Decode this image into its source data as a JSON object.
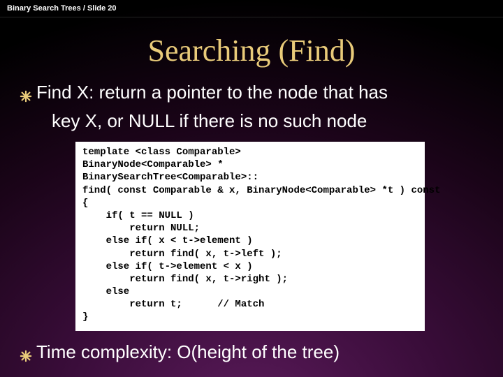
{
  "header": "Binary Search Trees / Slide 20",
  "title": "Searching (Find)",
  "bullets": {
    "b1_part1": "Find X: return a pointer to the node that has",
    "b1_part2": "key X, or NULL if there is no such node",
    "b2": "Time complexity: O(height of the tree)"
  },
  "code": "template <class Comparable>\nBinaryNode<Comparable> *\nBinarySearchTree<Comparable>::\nfind( const Comparable & x, BinaryNode<Comparable> *t ) const\n{\n    if( t == NULL )\n        return NULL;\n    else if( x < t->element )\n        return find( x, t->left );\n    else if( t->element < x )\n        return find( x, t->right );\n    else\n        return t;      // Match\n}"
}
